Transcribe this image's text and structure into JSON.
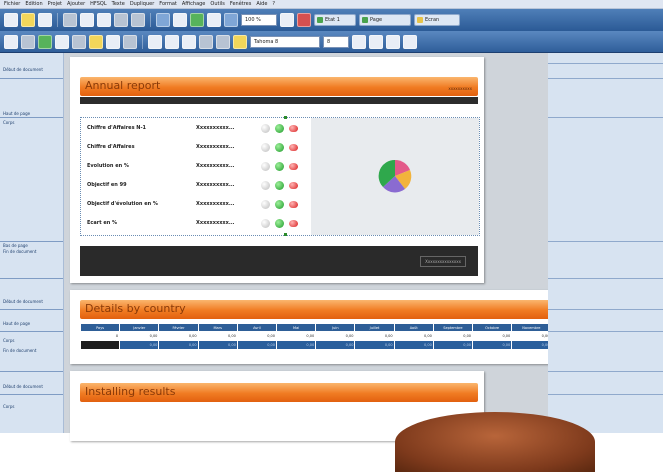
{
  "menu": [
    "Fichier",
    "Edition",
    "Projet",
    "Ajouter",
    "HFSQL",
    "Texte",
    "Dupliquer",
    "Format",
    "Affichage",
    "Outils",
    "Fenêtres",
    "Aide",
    "?"
  ],
  "toolbar": {
    "zoom": "100 %",
    "font": "Tahoma 8",
    "font_size": "8",
    "pills": [
      {
        "label": "Etat 1",
        "color": "#4aa34e"
      },
      {
        "label": "Page",
        "color": "#4aa34e"
      },
      {
        "label": "Ecran",
        "color": "#e6c34a"
      }
    ]
  },
  "left_panel": {
    "labels": [
      "Début de document",
      "Haut de page",
      "Corps",
      "Bas de page",
      "Fin de document",
      "Début de document",
      "Haut de page",
      "Corps",
      "Fin de document",
      "Début de document",
      "Corps"
    ]
  },
  "report1": {
    "title": "Annual report",
    "kpis": [
      {
        "label": "Chiffre d'Affaires N-1",
        "value": "Xxxxxxxxxx..."
      },
      {
        "label": "Chiffre d'Affaires",
        "value": "Xxxxxxxxxx..."
      },
      {
        "label": "Evolution en %",
        "value": "Xxxxxxxxxx..."
      },
      {
        "label": "Objectif en 99",
        "value": "Xxxxxxxxxx..."
      },
      {
        "label": "Objectif d'évolution en %",
        "value": "Xxxxxxxxxx..."
      },
      {
        "label": "Ecart en %",
        "value": "Xxxxxxxxxx..."
      }
    ],
    "footer_text": "Xxxxxxxxxxxxxxx"
  },
  "report2": {
    "title": "Details by country",
    "columns": [
      "Pays",
      "Janvier",
      "Février",
      "Mars",
      "Avril",
      "Mai",
      "Juin",
      "Juillet",
      "Août",
      "Septembre",
      "Octobre",
      "Novembre",
      "Décembre",
      "Cumul"
    ],
    "row1": [
      "X",
      "0,00",
      "0,00",
      "0,00",
      "0,00",
      "0,00",
      "0,00",
      "0,00",
      "0,00",
      "0,00",
      "0,00",
      "0,00",
      "0,00",
      "0,00"
    ],
    "row2": [
      "",
      "0,00",
      "0,00",
      "0,00",
      "0,00",
      "0,00",
      "0,00",
      "0,00",
      "0,00",
      "0,00",
      "0,00",
      "0,00",
      "0,00",
      "0,00"
    ]
  },
  "report3": {
    "title": "Installing results"
  }
}
